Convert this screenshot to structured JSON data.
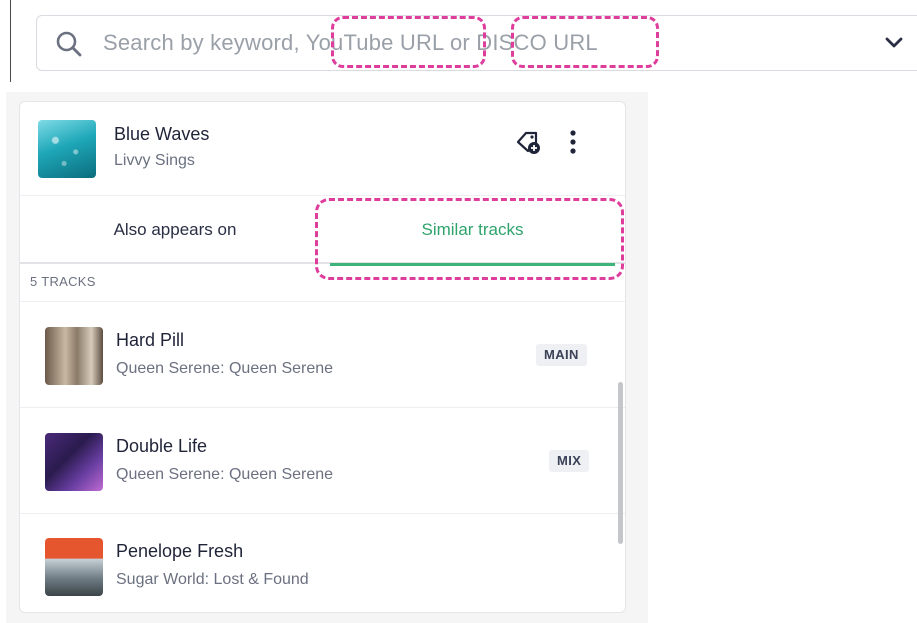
{
  "search": {
    "placeholder": "Search by keyword, YouTube URL or DISCO URL"
  },
  "header_track": {
    "title": "Blue Waves",
    "artist": "Livvy Sings"
  },
  "tabs": [
    {
      "label": "Also appears on",
      "active": false
    },
    {
      "label": "Similar tracks",
      "active": true
    }
  ],
  "track_count": "5 TRACKS",
  "tracks": [
    {
      "title": "Hard Pill",
      "subtitle": "Queen Serene: Queen Serene",
      "badge": "MAIN"
    },
    {
      "title": "Double Life",
      "subtitle": "Queen Serene: Queen Serene",
      "badge": "MIX"
    },
    {
      "title": "Penelope Fresh",
      "subtitle": "Sugar World: Lost & Found",
      "badge": ""
    }
  ],
  "colors": {
    "accent": "#3fb47a",
    "highlight": "#de3d9b"
  },
  "icons": [
    "search-icon",
    "chevron-down-icon",
    "tag-add-icon",
    "more-vertical-icon"
  ]
}
